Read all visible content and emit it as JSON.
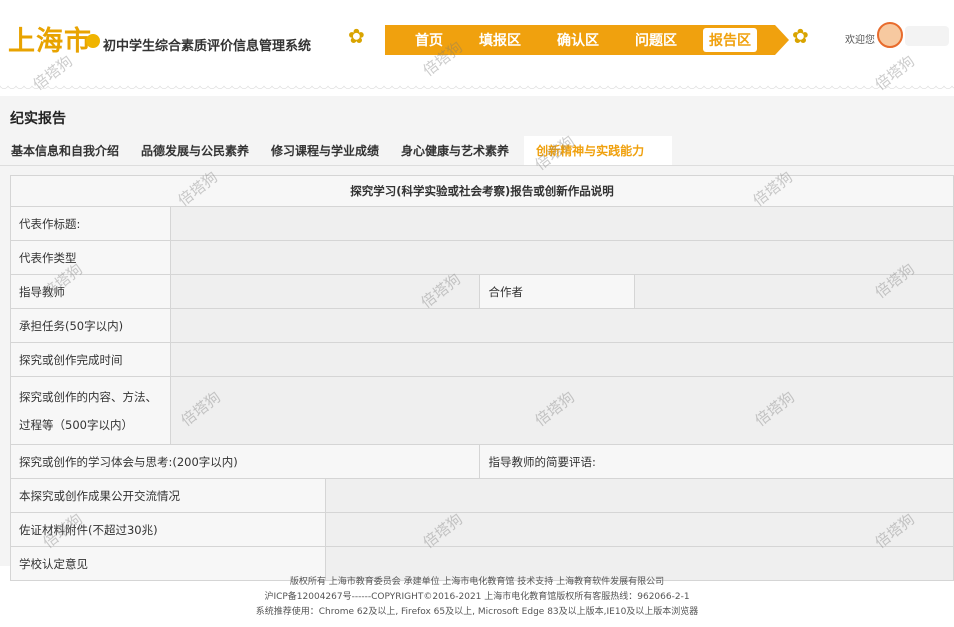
{
  "header": {
    "city": "上海市",
    "system_name": "初中学生综合素质评价信息管理系统",
    "nav": [
      "首页",
      "填报区",
      "确认区",
      "问题区",
      "报告区"
    ],
    "nav_active": "报告区",
    "welcome": "欢迎您"
  },
  "page": {
    "title": "纪实报告",
    "tabs": [
      "基本信息和自我介绍",
      "品德发展与公民素养",
      "修习课程与学业成绩",
      "身心健康与艺术素养",
      "创新精神与实践能力"
    ],
    "active_tab": "创新精神与实践能力"
  },
  "form": {
    "title": "探究学习(科学实验或社会考察)报告或创新作品说明",
    "rep_title": "代表作标题:",
    "rep_type": "代表作类型",
    "teacher": "指导教师",
    "partner": "合作者",
    "task": "承担任务(50字以内)",
    "finish_time": "探究或创作完成时间",
    "content_line1": "探究或创作的内容、方法、",
    "content_line2": "过程等（500字以内）",
    "reflection": "探究或创作的学习体会与思考:(200字以内)",
    "teacher_comment": "指导教师的简要评语:",
    "public": "本探究或创作成果公开交流情况",
    "evidence": "佐证材料附件(不超过30兆)",
    "school_confirm": "学校认定意见"
  },
  "footer": {
    "line1": "版权所有 上海市教育委员会    承建单位 上海市电化教育馆    技术支持 上海教育软件发展有限公司",
    "line2": "沪ICP备12004267号------COPYRIGHT©2016-2021 上海市电化教育馆版权所有客服热线：962066-2-1",
    "line3": "系统推荐使用：Chrome 62及以上, Firefox 65及以上, Microsoft Edge 83及以上版本,IE10及以上版本浏览器"
  },
  "watermark": "倍塔狗"
}
